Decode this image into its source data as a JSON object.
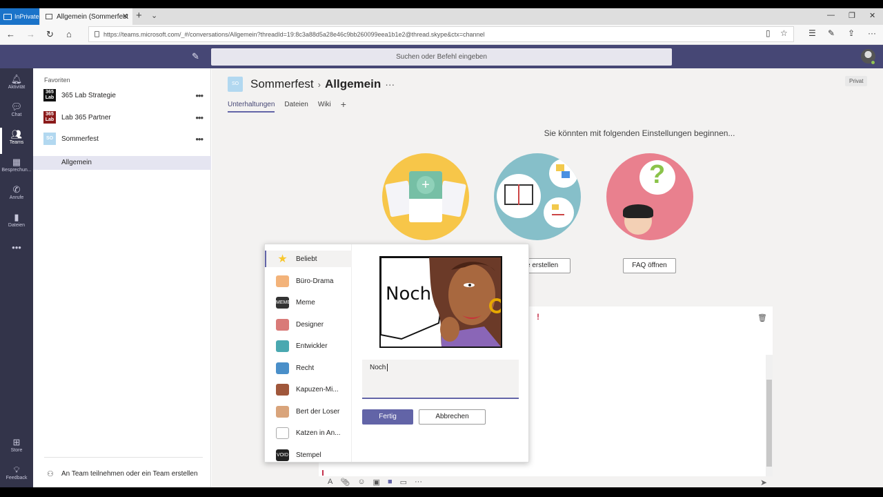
{
  "browser": {
    "inprivate_label": "InPrivate",
    "tab_title": "Allgemein (Sommerfest",
    "url": "https://teams.microsoft.com/_#/conversations/Allgemein?threadId=19:8c3a88d5a28e46c9bb260099eea1b1e2@thread.skype&ctx=channel"
  },
  "header": {
    "search_placeholder": "Suchen oder Befehl eingeben"
  },
  "rail": {
    "items": [
      {
        "label": "Aktivität",
        "icon": "bell-icon"
      },
      {
        "label": "Chat",
        "icon": "chat-icon"
      },
      {
        "label": "Teams",
        "icon": "teams-icon"
      },
      {
        "label": "Besprechun...",
        "icon": "calendar-icon"
      },
      {
        "label": "Anrufe",
        "icon": "phone-icon"
      },
      {
        "label": "Dateien",
        "icon": "file-icon"
      }
    ],
    "store_label": "Store",
    "feedback_label": "Feedback"
  },
  "sidebar": {
    "favorites_label": "Favoriten",
    "teams": [
      {
        "name": "365 Lab Strategie",
        "logo": "365 Lab"
      },
      {
        "name": "Lab 365 Partner",
        "logo": "365 Lab"
      },
      {
        "name": "Sommerfest",
        "logo": "SO"
      }
    ],
    "channel": "Allgemein",
    "footer_label": "An Team teilnehmen oder ein Team erstellen"
  },
  "channel": {
    "avatar": "SO",
    "team_name": "Sommerfest",
    "channel_name": "Allgemein",
    "privacy": "Privat",
    "tabs": [
      "Unterhaltungen",
      "Dateien",
      "Wiki"
    ],
    "getting_started": "Sie könnten mit folgenden Einstellungen beginnen...",
    "action_create": "le erstellen",
    "action_faq": "FAQ öffnen"
  },
  "meme_popup": {
    "categories": [
      {
        "label": "Beliebt",
        "icon": "star-icon",
        "color": "#f8c72d"
      },
      {
        "label": "Büro-Drama",
        "icon": "office-drama-icon",
        "color": "#f3b37a"
      },
      {
        "label": "Meme",
        "icon": "meme-icon",
        "color": "#333333"
      },
      {
        "label": "Designer",
        "icon": "designer-icon",
        "color": "#d97a78"
      },
      {
        "label": "Entwickler",
        "icon": "developer-icon",
        "color": "#4aa8b0"
      },
      {
        "label": "Recht",
        "icon": "law-icon",
        "color": "#4a8fc9"
      },
      {
        "label": "Kapuzen-Mi...",
        "icon": "hoodie-icon",
        "color": "#a0573b"
      },
      {
        "label": "Bert der Loser",
        "icon": "bert-icon",
        "color": "#d9a47b"
      },
      {
        "label": "Katzen in An...",
        "icon": "cat-icon",
        "color": "#aaaaaa"
      },
      {
        "label": "Stempel",
        "icon": "stamp-icon",
        "color": "#222222"
      }
    ],
    "meme_text": "Noch",
    "input_value": "Noch",
    "done_label": "Fertig",
    "cancel_label": "Abbrechen"
  },
  "colors": {
    "brand": "#464775",
    "accent": "#6264a7",
    "rail": "#33344a"
  }
}
